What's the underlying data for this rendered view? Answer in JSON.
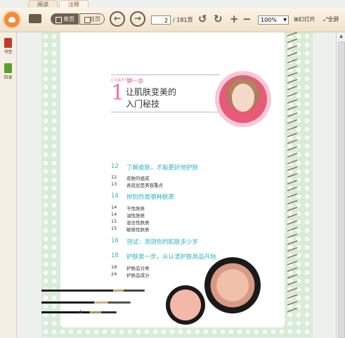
{
  "tabs": [
    "阅读",
    "注释"
  ],
  "toolbar": {
    "single_page": "单页",
    "double_page": "双页",
    "current_page": "2",
    "total_pages": "/ 181页",
    "zoom": "100%",
    "slideshow": "幻灯片",
    "fullscreen": "全屏"
  },
  "sidebar": {
    "bookmarks": "书签",
    "contents": "目录"
  },
  "page": {
    "chapter_english": "CHAPTER",
    "chapter_number": "1",
    "chapter_label": "第一章",
    "chapter_title_line1": "让肌肤变美的",
    "chapter_title_line2": "入门秘技",
    "page_number": "4",
    "toc": [
      {
        "num": "12",
        "text": "了解皮肤，才能更好地护肤",
        "level": "major"
      },
      {
        "num": "12",
        "text": "皮肤的组成",
        "level": "minor"
      },
      {
        "num": "13",
        "text": "表皮层是美容重点",
        "level": "minor"
      },
      {
        "num": "14",
        "text": "辨别你是哪种肤质",
        "level": "major"
      },
      {
        "num": "14",
        "text": "干性肤质",
        "level": "minor"
      },
      {
        "num": "14",
        "text": "油性肤质",
        "level": "minor"
      },
      {
        "num": "15",
        "text": "混合性肤质",
        "level": "minor"
      },
      {
        "num": "15",
        "text": "敏感性肤质",
        "level": "minor"
      },
      {
        "num": "16",
        "text": "测试：测测你的肌肤多少岁",
        "level": "major"
      },
      {
        "num": "18",
        "text": "护肤第一步，从认清护肤用品开始",
        "level": "major"
      },
      {
        "num": "18",
        "text": "护肤品分类",
        "level": "minor"
      },
      {
        "num": "24",
        "text": "护肤品成分",
        "level": "minor"
      }
    ]
  },
  "colors": {
    "accent_pink": "#e8769a",
    "accent_teal": "#2fb3c6",
    "page_bg": "#d9ecd9"
  }
}
